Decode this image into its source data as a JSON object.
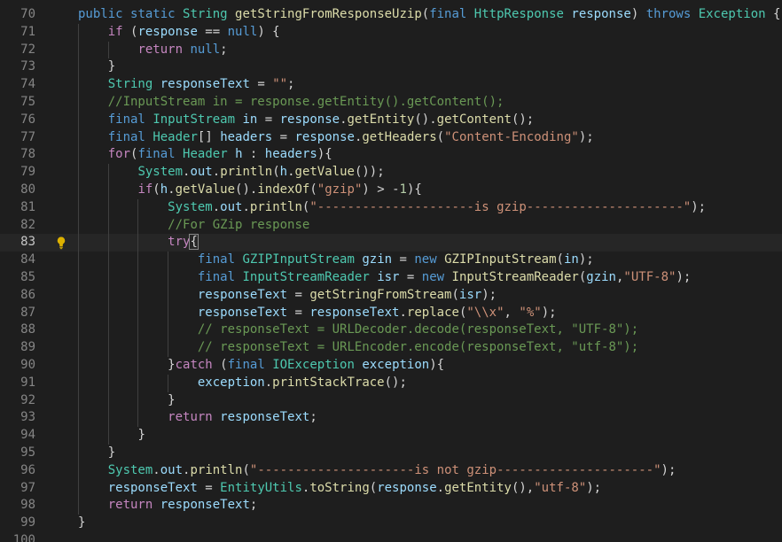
{
  "editor": {
    "lines": [
      {
        "n": "70",
        "indent": 1,
        "tokens": [
          [
            "kw",
            "public"
          ],
          [
            "op",
            " "
          ],
          [
            "kw",
            "static"
          ],
          [
            "op",
            " "
          ],
          [
            "ty",
            "String"
          ],
          [
            "op",
            " "
          ],
          [
            "fn",
            "getStringFromResponseUzip"
          ],
          [
            "op",
            "("
          ],
          [
            "kw",
            "final"
          ],
          [
            "op",
            " "
          ],
          [
            "ty",
            "HttpResponse"
          ],
          [
            "op",
            " "
          ],
          [
            "var",
            "response"
          ],
          [
            "op",
            ") "
          ],
          [
            "kw",
            "throws"
          ],
          [
            "op",
            " "
          ],
          [
            "ty",
            "Exception"
          ],
          [
            "op",
            " {"
          ]
        ]
      },
      {
        "n": "71",
        "indent": 2,
        "tokens": [
          [
            "ctl",
            "if"
          ],
          [
            "op",
            " ("
          ],
          [
            "var",
            "response"
          ],
          [
            "op",
            " == "
          ],
          [
            "kw",
            "null"
          ],
          [
            "op",
            ") {"
          ]
        ]
      },
      {
        "n": "72",
        "indent": 3,
        "tokens": [
          [
            "ctl",
            "return"
          ],
          [
            "op",
            " "
          ],
          [
            "kw",
            "null"
          ],
          [
            "op",
            ";"
          ]
        ]
      },
      {
        "n": "73",
        "indent": 2,
        "tokens": [
          [
            "op",
            "}"
          ]
        ]
      },
      {
        "n": "74",
        "indent": 2,
        "tokens": [
          [
            "ty",
            "String"
          ],
          [
            "op",
            " "
          ],
          [
            "var",
            "responseText"
          ],
          [
            "op",
            " = "
          ],
          [
            "str",
            "\"\""
          ],
          [
            "op",
            ";"
          ]
        ]
      },
      {
        "n": "75",
        "indent": 2,
        "tokens": [
          [
            "com",
            "//InputStream in = response.getEntity().getContent();"
          ]
        ]
      },
      {
        "n": "76",
        "indent": 2,
        "tokens": [
          [
            "kw",
            "final"
          ],
          [
            "op",
            " "
          ],
          [
            "ty",
            "InputStream"
          ],
          [
            "op",
            " "
          ],
          [
            "var",
            "in"
          ],
          [
            "op",
            " = "
          ],
          [
            "var",
            "response"
          ],
          [
            "op",
            "."
          ],
          [
            "fn",
            "getEntity"
          ],
          [
            "op",
            "()."
          ],
          [
            "fn",
            "getContent"
          ],
          [
            "op",
            "();"
          ]
        ]
      },
      {
        "n": "77",
        "indent": 2,
        "tokens": [
          [
            "kw",
            "final"
          ],
          [
            "op",
            " "
          ],
          [
            "ty",
            "Header"
          ],
          [
            "op",
            "[] "
          ],
          [
            "var",
            "headers"
          ],
          [
            "op",
            " = "
          ],
          [
            "var",
            "response"
          ],
          [
            "op",
            "."
          ],
          [
            "fn",
            "getHeaders"
          ],
          [
            "op",
            "("
          ],
          [
            "str",
            "\"Content-Encoding\""
          ],
          [
            "op",
            ");"
          ]
        ]
      },
      {
        "n": "78",
        "indent": 2,
        "tokens": [
          [
            "ctl",
            "for"
          ],
          [
            "op",
            "("
          ],
          [
            "kw",
            "final"
          ],
          [
            "op",
            " "
          ],
          [
            "ty",
            "Header"
          ],
          [
            "op",
            " "
          ],
          [
            "var",
            "h"
          ],
          [
            "op",
            " : "
          ],
          [
            "var",
            "headers"
          ],
          [
            "op",
            "){"
          ]
        ]
      },
      {
        "n": "79",
        "indent": 3,
        "tokens": [
          [
            "ty",
            "System"
          ],
          [
            "op",
            "."
          ],
          [
            "var",
            "out"
          ],
          [
            "op",
            "."
          ],
          [
            "fn",
            "println"
          ],
          [
            "op",
            "("
          ],
          [
            "var",
            "h"
          ],
          [
            "op",
            "."
          ],
          [
            "fn",
            "getValue"
          ],
          [
            "op",
            "());"
          ]
        ]
      },
      {
        "n": "80",
        "indent": 3,
        "tokens": [
          [
            "ctl",
            "if"
          ],
          [
            "op",
            "("
          ],
          [
            "var",
            "h"
          ],
          [
            "op",
            "."
          ],
          [
            "fn",
            "getValue"
          ],
          [
            "op",
            "()."
          ],
          [
            "fn",
            "indexOf"
          ],
          [
            "op",
            "("
          ],
          [
            "str",
            "\"gzip\""
          ],
          [
            "op",
            ") > -"
          ],
          [
            "num",
            "1"
          ],
          [
            "op",
            "){"
          ]
        ]
      },
      {
        "n": "81",
        "indent": 4,
        "tokens": [
          [
            "ty",
            "System"
          ],
          [
            "op",
            "."
          ],
          [
            "var",
            "out"
          ],
          [
            "op",
            "."
          ],
          [
            "fn",
            "println"
          ],
          [
            "op",
            "("
          ],
          [
            "str",
            "\"---------------------is gzip---------------------\""
          ],
          [
            "op",
            ");"
          ]
        ]
      },
      {
        "n": "82",
        "indent": 4,
        "tokens": [
          [
            "com",
            "//For GZip response"
          ]
        ]
      },
      {
        "n": "83",
        "indent": 4,
        "active": true,
        "tokens": [
          [
            "ctl",
            "try"
          ],
          [
            "op",
            "{"
          ]
        ]
      },
      {
        "n": "84",
        "indent": 5,
        "tokens": [
          [
            "kw",
            "final"
          ],
          [
            "op",
            " "
          ],
          [
            "ty",
            "GZIPInputStream"
          ],
          [
            "op",
            " "
          ],
          [
            "var",
            "gzin"
          ],
          [
            "op",
            " = "
          ],
          [
            "kw",
            "new"
          ],
          [
            "op",
            " "
          ],
          [
            "fn",
            "GZIPInputStream"
          ],
          [
            "op",
            "("
          ],
          [
            "var",
            "in"
          ],
          [
            "op",
            ");"
          ]
        ]
      },
      {
        "n": "85",
        "indent": 5,
        "tokens": [
          [
            "kw",
            "final"
          ],
          [
            "op",
            " "
          ],
          [
            "ty",
            "InputStreamReader"
          ],
          [
            "op",
            " "
          ],
          [
            "var",
            "isr"
          ],
          [
            "op",
            " = "
          ],
          [
            "kw",
            "new"
          ],
          [
            "op",
            " "
          ],
          [
            "fn",
            "InputStreamReader"
          ],
          [
            "op",
            "("
          ],
          [
            "var",
            "gzin"
          ],
          [
            "op",
            ","
          ],
          [
            "str",
            "\"UTF-8\""
          ],
          [
            "op",
            ");"
          ]
        ]
      },
      {
        "n": "86",
        "indent": 5,
        "tokens": [
          [
            "var",
            "responseText"
          ],
          [
            "op",
            " = "
          ],
          [
            "fn",
            "getStringFromStream"
          ],
          [
            "op",
            "("
          ],
          [
            "var",
            "isr"
          ],
          [
            "op",
            ");"
          ]
        ]
      },
      {
        "n": "87",
        "indent": 5,
        "tokens": [
          [
            "var",
            "responseText"
          ],
          [
            "op",
            " = "
          ],
          [
            "var",
            "responseText"
          ],
          [
            "op",
            "."
          ],
          [
            "fn",
            "replace"
          ],
          [
            "op",
            "("
          ],
          [
            "str",
            "\"\\\\x\""
          ],
          [
            "op",
            ", "
          ],
          [
            "str",
            "\"%\""
          ],
          [
            "op",
            ");"
          ]
        ]
      },
      {
        "n": "88",
        "indent": 5,
        "tokens": [
          [
            "com",
            "// responseText = URLDecoder.decode(responseText, \"UTF-8\");"
          ]
        ]
      },
      {
        "n": "89",
        "indent": 5,
        "tokens": [
          [
            "com",
            "// responseText = URLEncoder.encode(responseText, \"utf-8\");"
          ]
        ]
      },
      {
        "n": "90",
        "indent": 4,
        "tokens": [
          [
            "op",
            "}"
          ],
          [
            "ctl",
            "catch"
          ],
          [
            "op",
            " ("
          ],
          [
            "kw",
            "final"
          ],
          [
            "op",
            " "
          ],
          [
            "ty",
            "IOException"
          ],
          [
            "op",
            " "
          ],
          [
            "var",
            "exception"
          ],
          [
            "op",
            "){"
          ]
        ]
      },
      {
        "n": "91",
        "indent": 5,
        "tokens": [
          [
            "var",
            "exception"
          ],
          [
            "op",
            "."
          ],
          [
            "fn",
            "printStackTrace"
          ],
          [
            "op",
            "();"
          ]
        ]
      },
      {
        "n": "92",
        "indent": 4,
        "tokens": [
          [
            "op",
            "}"
          ]
        ]
      },
      {
        "n": "93",
        "indent": 4,
        "tokens": [
          [
            "ctl",
            "return"
          ],
          [
            "op",
            " "
          ],
          [
            "var",
            "responseText"
          ],
          [
            "op",
            ";"
          ]
        ]
      },
      {
        "n": "94",
        "indent": 3,
        "tokens": [
          [
            "op",
            "}"
          ]
        ]
      },
      {
        "n": "95",
        "indent": 2,
        "tokens": [
          [
            "op",
            "}"
          ]
        ]
      },
      {
        "n": "96",
        "indent": 2,
        "tokens": [
          [
            "ty",
            "System"
          ],
          [
            "op",
            "."
          ],
          [
            "var",
            "out"
          ],
          [
            "op",
            "."
          ],
          [
            "fn",
            "println"
          ],
          [
            "op",
            "("
          ],
          [
            "str",
            "\"---------------------is not gzip---------------------\""
          ],
          [
            "op",
            ");"
          ]
        ]
      },
      {
        "n": "97",
        "indent": 2,
        "tokens": [
          [
            "var",
            "responseText"
          ],
          [
            "op",
            " = "
          ],
          [
            "ty",
            "EntityUtils"
          ],
          [
            "op",
            "."
          ],
          [
            "fn",
            "toString"
          ],
          [
            "op",
            "("
          ],
          [
            "var",
            "response"
          ],
          [
            "op",
            "."
          ],
          [
            "fn",
            "getEntity"
          ],
          [
            "op",
            "(),"
          ],
          [
            "str",
            "\"utf-8\""
          ],
          [
            "op",
            ");"
          ]
        ]
      },
      {
        "n": "98",
        "indent": 2,
        "tokens": [
          [
            "ctl",
            "return"
          ],
          [
            "op",
            " "
          ],
          [
            "var",
            "responseText"
          ],
          [
            "op",
            ";"
          ]
        ]
      },
      {
        "n": "99",
        "indent": 1,
        "tokens": [
          [
            "op",
            "}"
          ]
        ]
      },
      {
        "n": "100",
        "indent": 0,
        "tokens": []
      }
    ],
    "lightbulb_line": "83",
    "colors": {
      "background": "#1e1e1e",
      "gutter_text": "#858585",
      "keyword": "#569cd6",
      "control": "#c586c0",
      "type": "#4ec9b0",
      "variable": "#9cdcfe",
      "function": "#dcdcaa",
      "string": "#ce9178",
      "number": "#b5cea8",
      "comment": "#6a9955"
    }
  }
}
